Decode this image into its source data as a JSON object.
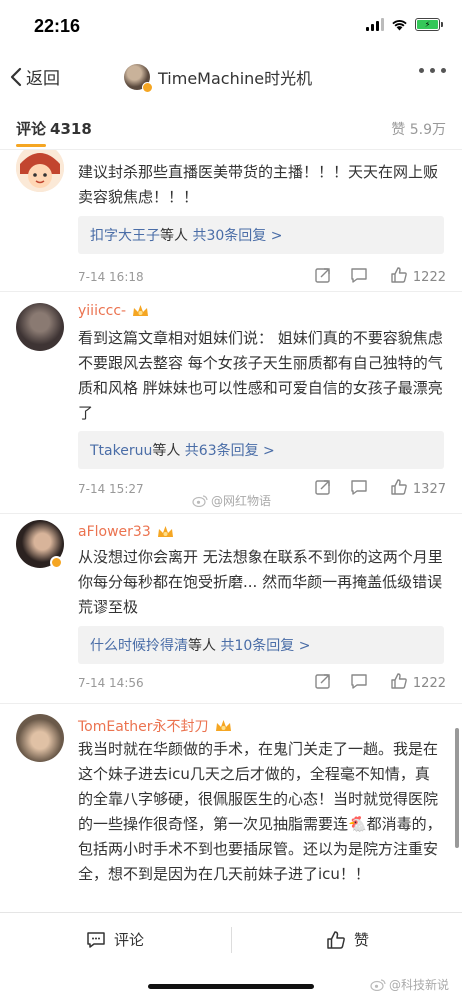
{
  "status_bar": {
    "time": "22:16"
  },
  "nav": {
    "back_label": "返回",
    "title": "TimeMachine时光机"
  },
  "tabs": {
    "comments_label": "评论",
    "comments_count": "4318",
    "likes_label": "赞 5.9万"
  },
  "comments": [
    {
      "text": "建议封杀那些直播医美带货的主播！！！天天在网上贩卖容貌焦虑！！！",
      "reply_user": "扣字大王子",
      "reply_mid": "等人",
      "reply_count": "共30条回复 >",
      "time": "7-14 16:18",
      "likes": "1222"
    },
    {
      "name": "yiiiccc-",
      "text": "看到这篇文章相对姐妹们说： 姐妹们真的不要容貌焦虑不要跟风去整容 每个女孩子天生丽质都有自己独特的气质和风格 胖妹妹也可以性感和可爱自信的女孩子最漂亮了",
      "reply_user": "Ttakeruu",
      "reply_mid": "等人",
      "reply_count": "共63条回复 >",
      "time": "7-14 15:27",
      "likes": "1327"
    },
    {
      "name": "aFlower33",
      "text": "从没想过你会离开 无法想象在联系不到你的这两个月里 你每分每秒都在饱受折磨... 然而华颜一再掩盖低级错误 荒谬至极",
      "reply_user": "什么时候拎得清",
      "reply_mid": "等人",
      "reply_count": "共10条回复 >",
      "time": "7-14 14:56",
      "likes": "1222"
    },
    {
      "name": "TomEather永不封刀",
      "text": "我当时就在华颜做的手术，在鬼门关走了一趟。我是在这个妹子进去icu几天之后才做的，全程毫不知情，真的全靠八字够硬，很佩服医生的心态！当时就觉得医院的一些操作很奇怪，第一次见抽脂需要连🐔都消毒的，包括两小时手术不到也要插尿管。还以为是院方注重安全，想不到是因为在几天前妹子进了icu！！"
    }
  ],
  "watermarks": {
    "first": "@网红物语",
    "second": "@科技新说"
  },
  "bottom_bar": {
    "comment_label": "评论",
    "like_label": "赞"
  },
  "colors": {
    "name": "#eb7350",
    "link": "#4a6da7",
    "badge": "#f5a623"
  }
}
